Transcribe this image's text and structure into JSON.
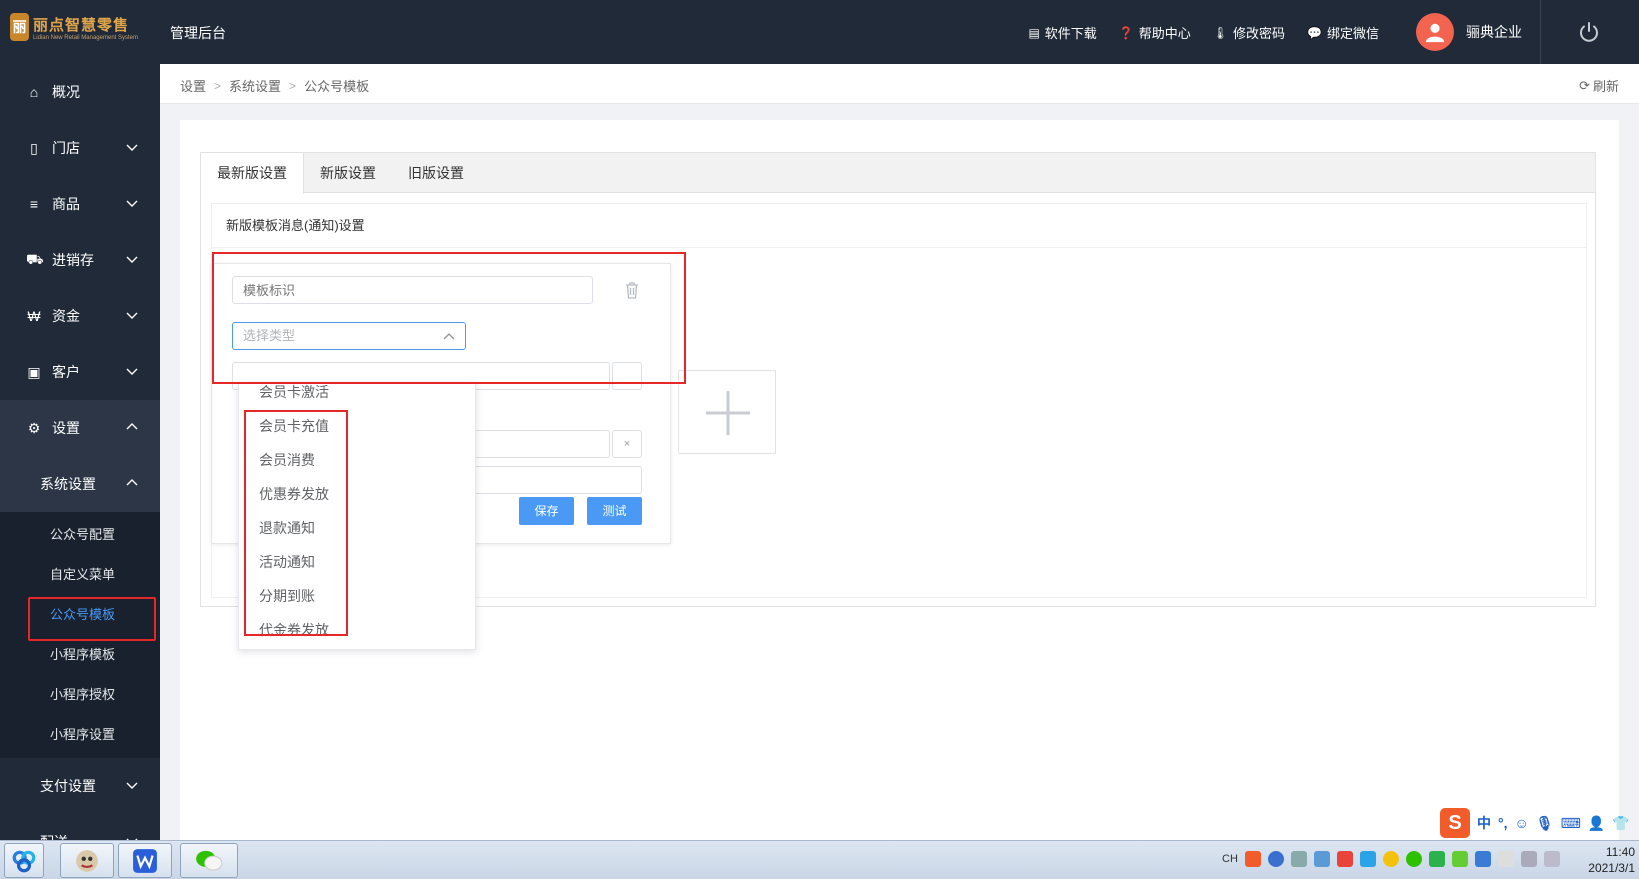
{
  "header": {
    "logo_text": "丽点智慧零售",
    "logo_subtext": "Lidian New Retail Management System",
    "admin_title": "管理后台",
    "links": [
      {
        "label": "软件下载",
        "icon": "store-icon"
      },
      {
        "label": "帮助中心",
        "icon": "help-icon"
      },
      {
        "label": "修改密码",
        "icon": "thermometer-icon"
      },
      {
        "label": "绑定微信",
        "icon": "wechat-icon"
      }
    ],
    "user_name": "骊典企业"
  },
  "sidebar": {
    "items": [
      {
        "label": "概况",
        "icon": "home-icon"
      },
      {
        "label": "门店",
        "icon": "store-doc-icon"
      },
      {
        "label": "商品",
        "icon": "menu-lines-icon"
      },
      {
        "label": "进销存",
        "icon": "truck-icon"
      },
      {
        "label": "资金",
        "icon": "currency-icon"
      },
      {
        "label": "客户",
        "icon": "id-card-icon"
      },
      {
        "label": "设置",
        "icon": "gear-icon"
      }
    ],
    "system_settings": "系统设置",
    "sub_items": [
      "公众号配置",
      "自定义菜单",
      "公众号模板",
      "小程序模板",
      "小程序授权",
      "小程序设置"
    ],
    "payment_settings": "支付设置",
    "delivery": "配送"
  },
  "breadcrumb": {
    "items": [
      "设置",
      "系统设置",
      "公众号模板"
    ],
    "refresh": "刷新"
  },
  "tabs": [
    "最新版设置",
    "新版设置",
    "旧版设置"
  ],
  "section_title": "新版模板消息(通知)设置",
  "form": {
    "template_id_placeholder": "模板标识",
    "type_placeholder": "选择类型",
    "clear_symbol": "×",
    "save": "保存",
    "test": "测试"
  },
  "dropdown_options": [
    "会员卡激活",
    "会员卡充值",
    "会员消费",
    "优惠券发放",
    "退款通知",
    "活动通知",
    "分期到账",
    "代金券发放"
  ],
  "taskbar": {
    "lang": "CH",
    "time": "11:40",
    "date": "2021/3/1",
    "ime_logo": "S",
    "ime_mode": "中"
  },
  "colors": {
    "sidebar_bg": "#202a38",
    "accent": "#4a9af5",
    "highlight_red": "#e62727"
  }
}
